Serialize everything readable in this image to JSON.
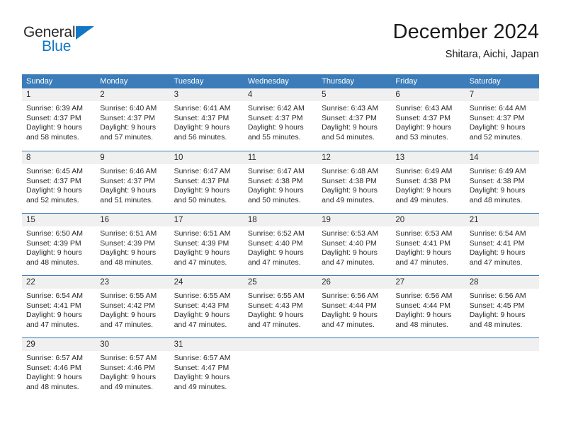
{
  "brand": {
    "name_part1": "General",
    "name_part2": "Blue",
    "accent_color": "#1277c4",
    "triangle_icon": "triangle-icon"
  },
  "header": {
    "month_title": "December 2024",
    "location": "Shitara, Aichi, Japan"
  },
  "calendar": {
    "header_color": "#3b7cb9",
    "daynum_bg": "#f0f0f0",
    "weekdays": [
      "Sunday",
      "Monday",
      "Tuesday",
      "Wednesday",
      "Thursday",
      "Friday",
      "Saturday"
    ],
    "weeks": [
      [
        {
          "day": "1",
          "sunrise": "Sunrise: 6:39 AM",
          "sunset": "Sunset: 4:37 PM",
          "daylight_line1": "Daylight: 9 hours",
          "daylight_line2": "and 58 minutes."
        },
        {
          "day": "2",
          "sunrise": "Sunrise: 6:40 AM",
          "sunset": "Sunset: 4:37 PM",
          "daylight_line1": "Daylight: 9 hours",
          "daylight_line2": "and 57 minutes."
        },
        {
          "day": "3",
          "sunrise": "Sunrise: 6:41 AM",
          "sunset": "Sunset: 4:37 PM",
          "daylight_line1": "Daylight: 9 hours",
          "daylight_line2": "and 56 minutes."
        },
        {
          "day": "4",
          "sunrise": "Sunrise: 6:42 AM",
          "sunset": "Sunset: 4:37 PM",
          "daylight_line1": "Daylight: 9 hours",
          "daylight_line2": "and 55 minutes."
        },
        {
          "day": "5",
          "sunrise": "Sunrise: 6:43 AM",
          "sunset": "Sunset: 4:37 PM",
          "daylight_line1": "Daylight: 9 hours",
          "daylight_line2": "and 54 minutes."
        },
        {
          "day": "6",
          "sunrise": "Sunrise: 6:43 AM",
          "sunset": "Sunset: 4:37 PM",
          "daylight_line1": "Daylight: 9 hours",
          "daylight_line2": "and 53 minutes."
        },
        {
          "day": "7",
          "sunrise": "Sunrise: 6:44 AM",
          "sunset": "Sunset: 4:37 PM",
          "daylight_line1": "Daylight: 9 hours",
          "daylight_line2": "and 52 minutes."
        }
      ],
      [
        {
          "day": "8",
          "sunrise": "Sunrise: 6:45 AM",
          "sunset": "Sunset: 4:37 PM",
          "daylight_line1": "Daylight: 9 hours",
          "daylight_line2": "and 52 minutes."
        },
        {
          "day": "9",
          "sunrise": "Sunrise: 6:46 AM",
          "sunset": "Sunset: 4:37 PM",
          "daylight_line1": "Daylight: 9 hours",
          "daylight_line2": "and 51 minutes."
        },
        {
          "day": "10",
          "sunrise": "Sunrise: 6:47 AM",
          "sunset": "Sunset: 4:37 PM",
          "daylight_line1": "Daylight: 9 hours",
          "daylight_line2": "and 50 minutes."
        },
        {
          "day": "11",
          "sunrise": "Sunrise: 6:47 AM",
          "sunset": "Sunset: 4:38 PM",
          "daylight_line1": "Daylight: 9 hours",
          "daylight_line2": "and 50 minutes."
        },
        {
          "day": "12",
          "sunrise": "Sunrise: 6:48 AM",
          "sunset": "Sunset: 4:38 PM",
          "daylight_line1": "Daylight: 9 hours",
          "daylight_line2": "and 49 minutes."
        },
        {
          "day": "13",
          "sunrise": "Sunrise: 6:49 AM",
          "sunset": "Sunset: 4:38 PM",
          "daylight_line1": "Daylight: 9 hours",
          "daylight_line2": "and 49 minutes."
        },
        {
          "day": "14",
          "sunrise": "Sunrise: 6:49 AM",
          "sunset": "Sunset: 4:38 PM",
          "daylight_line1": "Daylight: 9 hours",
          "daylight_line2": "and 48 minutes."
        }
      ],
      [
        {
          "day": "15",
          "sunrise": "Sunrise: 6:50 AM",
          "sunset": "Sunset: 4:39 PM",
          "daylight_line1": "Daylight: 9 hours",
          "daylight_line2": "and 48 minutes."
        },
        {
          "day": "16",
          "sunrise": "Sunrise: 6:51 AM",
          "sunset": "Sunset: 4:39 PM",
          "daylight_line1": "Daylight: 9 hours",
          "daylight_line2": "and 48 minutes."
        },
        {
          "day": "17",
          "sunrise": "Sunrise: 6:51 AM",
          "sunset": "Sunset: 4:39 PM",
          "daylight_line1": "Daylight: 9 hours",
          "daylight_line2": "and 47 minutes."
        },
        {
          "day": "18",
          "sunrise": "Sunrise: 6:52 AM",
          "sunset": "Sunset: 4:40 PM",
          "daylight_line1": "Daylight: 9 hours",
          "daylight_line2": "and 47 minutes."
        },
        {
          "day": "19",
          "sunrise": "Sunrise: 6:53 AM",
          "sunset": "Sunset: 4:40 PM",
          "daylight_line1": "Daylight: 9 hours",
          "daylight_line2": "and 47 minutes."
        },
        {
          "day": "20",
          "sunrise": "Sunrise: 6:53 AM",
          "sunset": "Sunset: 4:41 PM",
          "daylight_line1": "Daylight: 9 hours",
          "daylight_line2": "and 47 minutes."
        },
        {
          "day": "21",
          "sunrise": "Sunrise: 6:54 AM",
          "sunset": "Sunset: 4:41 PM",
          "daylight_line1": "Daylight: 9 hours",
          "daylight_line2": "and 47 minutes."
        }
      ],
      [
        {
          "day": "22",
          "sunrise": "Sunrise: 6:54 AM",
          "sunset": "Sunset: 4:41 PM",
          "daylight_line1": "Daylight: 9 hours",
          "daylight_line2": "and 47 minutes."
        },
        {
          "day": "23",
          "sunrise": "Sunrise: 6:55 AM",
          "sunset": "Sunset: 4:42 PM",
          "daylight_line1": "Daylight: 9 hours",
          "daylight_line2": "and 47 minutes."
        },
        {
          "day": "24",
          "sunrise": "Sunrise: 6:55 AM",
          "sunset": "Sunset: 4:43 PM",
          "daylight_line1": "Daylight: 9 hours",
          "daylight_line2": "and 47 minutes."
        },
        {
          "day": "25",
          "sunrise": "Sunrise: 6:55 AM",
          "sunset": "Sunset: 4:43 PM",
          "daylight_line1": "Daylight: 9 hours",
          "daylight_line2": "and 47 minutes."
        },
        {
          "day": "26",
          "sunrise": "Sunrise: 6:56 AM",
          "sunset": "Sunset: 4:44 PM",
          "daylight_line1": "Daylight: 9 hours",
          "daylight_line2": "and 47 minutes."
        },
        {
          "day": "27",
          "sunrise": "Sunrise: 6:56 AM",
          "sunset": "Sunset: 4:44 PM",
          "daylight_line1": "Daylight: 9 hours",
          "daylight_line2": "and 48 minutes."
        },
        {
          "day": "28",
          "sunrise": "Sunrise: 6:56 AM",
          "sunset": "Sunset: 4:45 PM",
          "daylight_line1": "Daylight: 9 hours",
          "daylight_line2": "and 48 minutes."
        }
      ],
      [
        {
          "day": "29",
          "sunrise": "Sunrise: 6:57 AM",
          "sunset": "Sunset: 4:46 PM",
          "daylight_line1": "Daylight: 9 hours",
          "daylight_line2": "and 48 minutes."
        },
        {
          "day": "30",
          "sunrise": "Sunrise: 6:57 AM",
          "sunset": "Sunset: 4:46 PM",
          "daylight_line1": "Daylight: 9 hours",
          "daylight_line2": "and 49 minutes."
        },
        {
          "day": "31",
          "sunrise": "Sunrise: 6:57 AM",
          "sunset": "Sunset: 4:47 PM",
          "daylight_line1": "Daylight: 9 hours",
          "daylight_line2": "and 49 minutes."
        },
        {
          "day": "",
          "sunrise": "",
          "sunset": "",
          "daylight_line1": "",
          "daylight_line2": ""
        },
        {
          "day": "",
          "sunrise": "",
          "sunset": "",
          "daylight_line1": "",
          "daylight_line2": ""
        },
        {
          "day": "",
          "sunrise": "",
          "sunset": "",
          "daylight_line1": "",
          "daylight_line2": ""
        },
        {
          "day": "",
          "sunrise": "",
          "sunset": "",
          "daylight_line1": "",
          "daylight_line2": ""
        }
      ]
    ]
  }
}
